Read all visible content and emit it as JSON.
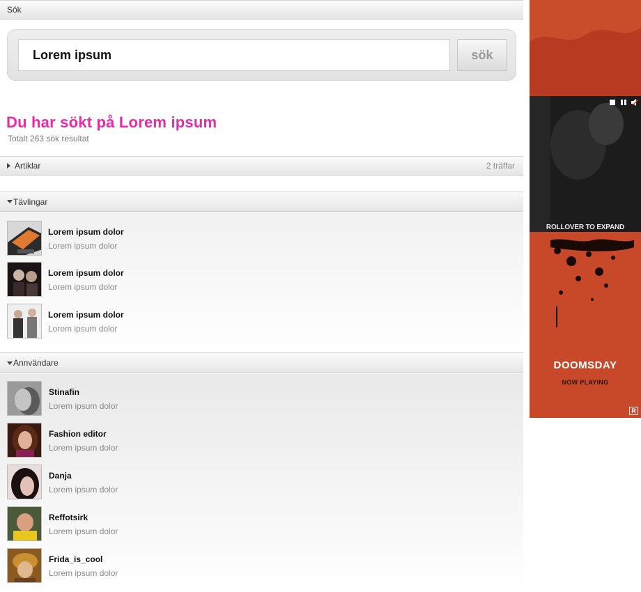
{
  "search": {
    "header": "Sök",
    "value": "Lorem ipsum",
    "button": "sök"
  },
  "results": {
    "title": "Du har sökt på Lorem ipsum",
    "count": "Totalt 263 sök resultat"
  },
  "sections": {
    "articles": {
      "label": "Artiklar",
      "hits": "2 träffar"
    },
    "competitions": {
      "label": "Tävlingar",
      "items": [
        {
          "title": "Lorem ipsum dolor",
          "subtitle": "Lorem ipsum dolor"
        },
        {
          "title": "Lorem ipsum dolor",
          "subtitle": "Lorem ipsum dolor"
        },
        {
          "title": "Lorem ipsum dolor",
          "subtitle": "Lorem ipsum dolor"
        }
      ]
    },
    "users": {
      "label": "Annvändare",
      "items": [
        {
          "name": "Stinafin",
          "subtitle": "Lorem ipsum dolor"
        },
        {
          "name": "Fashion editor",
          "subtitle": "Lorem ipsum dolor"
        },
        {
          "name": "Danja",
          "subtitle": "Lorem ipsum dolor"
        },
        {
          "name": "Reffotsirk",
          "subtitle": "Lorem ipsum dolor"
        },
        {
          "name": "Frida_is_cool",
          "subtitle": "Lorem ipsum dolor"
        }
      ]
    }
  },
  "ad": {
    "rollover": "ROLLOVER TO EXPAND",
    "movie": "DOOMSDAY",
    "tagline": "NOW PLAYING",
    "rating": "R",
    "accent": "#c8482a"
  },
  "colors": {
    "result_title": "#e82aa8"
  }
}
